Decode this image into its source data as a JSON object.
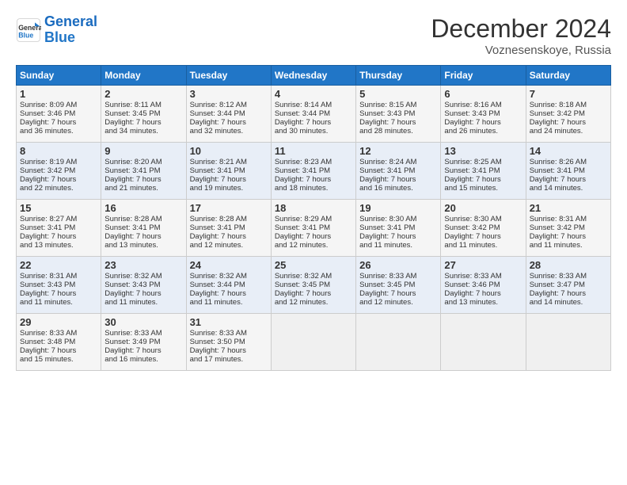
{
  "header": {
    "logo_line1": "General",
    "logo_line2": "Blue",
    "month_title": "December 2024",
    "location": "Voznesenskoye, Russia"
  },
  "days_of_week": [
    "Sunday",
    "Monday",
    "Tuesday",
    "Wednesday",
    "Thursday",
    "Friday",
    "Saturday"
  ],
  "weeks": [
    [
      {
        "day": "1",
        "lines": [
          "Sunrise: 8:09 AM",
          "Sunset: 3:46 PM",
          "Daylight: 7 hours",
          "and 36 minutes."
        ]
      },
      {
        "day": "2",
        "lines": [
          "Sunrise: 8:11 AM",
          "Sunset: 3:45 PM",
          "Daylight: 7 hours",
          "and 34 minutes."
        ]
      },
      {
        "day": "3",
        "lines": [
          "Sunrise: 8:12 AM",
          "Sunset: 3:44 PM",
          "Daylight: 7 hours",
          "and 32 minutes."
        ]
      },
      {
        "day": "4",
        "lines": [
          "Sunrise: 8:14 AM",
          "Sunset: 3:44 PM",
          "Daylight: 7 hours",
          "and 30 minutes."
        ]
      },
      {
        "day": "5",
        "lines": [
          "Sunrise: 8:15 AM",
          "Sunset: 3:43 PM",
          "Daylight: 7 hours",
          "and 28 minutes."
        ]
      },
      {
        "day": "6",
        "lines": [
          "Sunrise: 8:16 AM",
          "Sunset: 3:43 PM",
          "Daylight: 7 hours",
          "and 26 minutes."
        ]
      },
      {
        "day": "7",
        "lines": [
          "Sunrise: 8:18 AM",
          "Sunset: 3:42 PM",
          "Daylight: 7 hours",
          "and 24 minutes."
        ]
      }
    ],
    [
      {
        "day": "8",
        "lines": [
          "Sunrise: 8:19 AM",
          "Sunset: 3:42 PM",
          "Daylight: 7 hours",
          "and 22 minutes."
        ]
      },
      {
        "day": "9",
        "lines": [
          "Sunrise: 8:20 AM",
          "Sunset: 3:41 PM",
          "Daylight: 7 hours",
          "and 21 minutes."
        ]
      },
      {
        "day": "10",
        "lines": [
          "Sunrise: 8:21 AM",
          "Sunset: 3:41 PM",
          "Daylight: 7 hours",
          "and 19 minutes."
        ]
      },
      {
        "day": "11",
        "lines": [
          "Sunrise: 8:23 AM",
          "Sunset: 3:41 PM",
          "Daylight: 7 hours",
          "and 18 minutes."
        ]
      },
      {
        "day": "12",
        "lines": [
          "Sunrise: 8:24 AM",
          "Sunset: 3:41 PM",
          "Daylight: 7 hours",
          "and 16 minutes."
        ]
      },
      {
        "day": "13",
        "lines": [
          "Sunrise: 8:25 AM",
          "Sunset: 3:41 PM",
          "Daylight: 7 hours",
          "and 15 minutes."
        ]
      },
      {
        "day": "14",
        "lines": [
          "Sunrise: 8:26 AM",
          "Sunset: 3:41 PM",
          "Daylight: 7 hours",
          "and 14 minutes."
        ]
      }
    ],
    [
      {
        "day": "15",
        "lines": [
          "Sunrise: 8:27 AM",
          "Sunset: 3:41 PM",
          "Daylight: 7 hours",
          "and 13 minutes."
        ]
      },
      {
        "day": "16",
        "lines": [
          "Sunrise: 8:28 AM",
          "Sunset: 3:41 PM",
          "Daylight: 7 hours",
          "and 13 minutes."
        ]
      },
      {
        "day": "17",
        "lines": [
          "Sunrise: 8:28 AM",
          "Sunset: 3:41 PM",
          "Daylight: 7 hours",
          "and 12 minutes."
        ]
      },
      {
        "day": "18",
        "lines": [
          "Sunrise: 8:29 AM",
          "Sunset: 3:41 PM",
          "Daylight: 7 hours",
          "and 12 minutes."
        ]
      },
      {
        "day": "19",
        "lines": [
          "Sunrise: 8:30 AM",
          "Sunset: 3:41 PM",
          "Daylight: 7 hours",
          "and 11 minutes."
        ]
      },
      {
        "day": "20",
        "lines": [
          "Sunrise: 8:30 AM",
          "Sunset: 3:42 PM",
          "Daylight: 7 hours",
          "and 11 minutes."
        ]
      },
      {
        "day": "21",
        "lines": [
          "Sunrise: 8:31 AM",
          "Sunset: 3:42 PM",
          "Daylight: 7 hours",
          "and 11 minutes."
        ]
      }
    ],
    [
      {
        "day": "22",
        "lines": [
          "Sunrise: 8:31 AM",
          "Sunset: 3:43 PM",
          "Daylight: 7 hours",
          "and 11 minutes."
        ]
      },
      {
        "day": "23",
        "lines": [
          "Sunrise: 8:32 AM",
          "Sunset: 3:43 PM",
          "Daylight: 7 hours",
          "and 11 minutes."
        ]
      },
      {
        "day": "24",
        "lines": [
          "Sunrise: 8:32 AM",
          "Sunset: 3:44 PM",
          "Daylight: 7 hours",
          "and 11 minutes."
        ]
      },
      {
        "day": "25",
        "lines": [
          "Sunrise: 8:32 AM",
          "Sunset: 3:45 PM",
          "Daylight: 7 hours",
          "and 12 minutes."
        ]
      },
      {
        "day": "26",
        "lines": [
          "Sunrise: 8:33 AM",
          "Sunset: 3:45 PM",
          "Daylight: 7 hours",
          "and 12 minutes."
        ]
      },
      {
        "day": "27",
        "lines": [
          "Sunrise: 8:33 AM",
          "Sunset: 3:46 PM",
          "Daylight: 7 hours",
          "and 13 minutes."
        ]
      },
      {
        "day": "28",
        "lines": [
          "Sunrise: 8:33 AM",
          "Sunset: 3:47 PM",
          "Daylight: 7 hours",
          "and 14 minutes."
        ]
      }
    ],
    [
      {
        "day": "29",
        "lines": [
          "Sunrise: 8:33 AM",
          "Sunset: 3:48 PM",
          "Daylight: 7 hours",
          "and 15 minutes."
        ]
      },
      {
        "day": "30",
        "lines": [
          "Sunrise: 8:33 AM",
          "Sunset: 3:49 PM",
          "Daylight: 7 hours",
          "and 16 minutes."
        ]
      },
      {
        "day": "31",
        "lines": [
          "Sunrise: 8:33 AM",
          "Sunset: 3:50 PM",
          "Daylight: 7 hours",
          "and 17 minutes."
        ]
      },
      null,
      null,
      null,
      null
    ]
  ]
}
